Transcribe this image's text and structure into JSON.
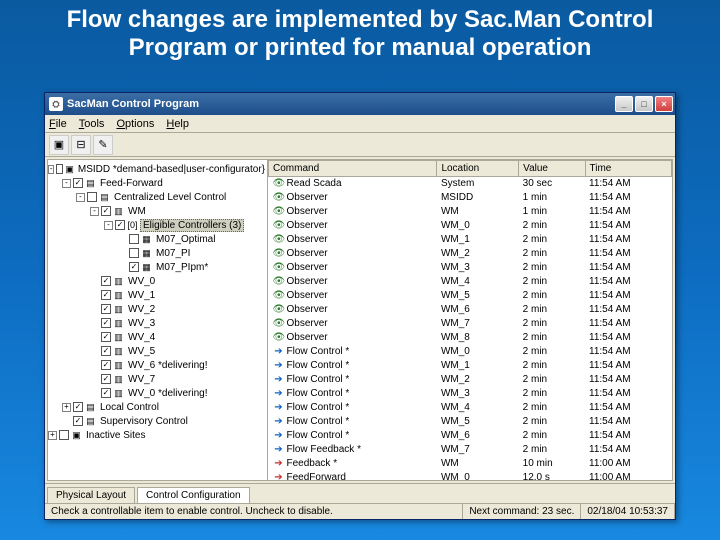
{
  "slide": {
    "title": "Flow changes are implemented by Sac.Man Control Program or printed for manual operation"
  },
  "window": {
    "title": "SacMan Control Program",
    "menu": {
      "file": "File",
      "tools": "Tools",
      "options": "Options",
      "help": "Help"
    },
    "win": {
      "min": "_",
      "max": "□",
      "close": "×"
    }
  },
  "tree": [
    {
      "d": 0,
      "exp": "-",
      "chk": "",
      "ico": "▣",
      "label": "MSIDD *demand-based|user-configurator}"
    },
    {
      "d": 1,
      "exp": "-",
      "chk": "✓",
      "ico": "▤",
      "label": "Feed-Forward"
    },
    {
      "d": 2,
      "exp": "-",
      "chk": "",
      "ico": "▤",
      "label": "Centralized Level Control"
    },
    {
      "d": 3,
      "exp": "-",
      "chk": "✓",
      "ico": "▥",
      "label": "WM"
    },
    {
      "d": 4,
      "exp": "-",
      "chk": "✓",
      "ico": "[0]",
      "label": "Eligible Controllers (3)",
      "sel": true
    },
    {
      "d": 5,
      "exp": "",
      "chk": "",
      "ico": "▦",
      "label": "M07_Optimal"
    },
    {
      "d": 5,
      "exp": "",
      "chk": "",
      "ico": "▦",
      "label": "M07_PI"
    },
    {
      "d": 5,
      "exp": "",
      "chk": "✓",
      "ico": "▦",
      "label": "M07_PIpm*"
    },
    {
      "d": 3,
      "exp": "",
      "chk": "✓",
      "ico": "▥",
      "label": "WV_0"
    },
    {
      "d": 3,
      "exp": "",
      "chk": "✓",
      "ico": "▥",
      "label": "WV_1"
    },
    {
      "d": 3,
      "exp": "",
      "chk": "✓",
      "ico": "▥",
      "label": "WV_2"
    },
    {
      "d": 3,
      "exp": "",
      "chk": "✓",
      "ico": "▥",
      "label": "WV_3"
    },
    {
      "d": 3,
      "exp": "",
      "chk": "✓",
      "ico": "▥",
      "label": "WV_4"
    },
    {
      "d": 3,
      "exp": "",
      "chk": "✓",
      "ico": "▥",
      "label": "WV_5"
    },
    {
      "d": 3,
      "exp": "",
      "chk": "✓",
      "ico": "▥",
      "label": "WV_6 *delivering!"
    },
    {
      "d": 3,
      "exp": "",
      "chk": "✓",
      "ico": "▥",
      "label": "WV_7"
    },
    {
      "d": 3,
      "exp": "",
      "chk": "✓",
      "ico": "▥",
      "label": "WV_0 *delivering!"
    },
    {
      "d": 1,
      "exp": "+",
      "chk": "✓",
      "ico": "▤",
      "label": "Local Control"
    },
    {
      "d": 1,
      "exp": "",
      "chk": "✓",
      "ico": "▤",
      "label": "Supervisory Control"
    },
    {
      "d": 0,
      "exp": "+",
      "chk": "",
      "ico": "▣",
      "label": "Inactive Sites"
    }
  ],
  "columns": {
    "command": "Command",
    "location": "Location",
    "value": "Value",
    "time": "Time"
  },
  "rows": [
    {
      "icon": "eye",
      "cmd": "Read Scada",
      "loc": "System",
      "val": "30 sec",
      "time": "11:54 AM"
    },
    {
      "icon": "eye",
      "cmd": "Observer",
      "loc": "MSIDD",
      "val": "1 min",
      "time": "11:54 AM"
    },
    {
      "icon": "eye",
      "cmd": "Observer",
      "loc": "WM",
      "val": "1 min",
      "time": "11:54 AM"
    },
    {
      "icon": "eye",
      "cmd": "Observer",
      "loc": "WM_0",
      "val": "2 min",
      "time": "11:54 AM"
    },
    {
      "icon": "eye",
      "cmd": "Observer",
      "loc": "WM_1",
      "val": "2 min",
      "time": "11:54 AM"
    },
    {
      "icon": "eye",
      "cmd": "Observer",
      "loc": "WM_2",
      "val": "2 min",
      "time": "11:54 AM"
    },
    {
      "icon": "eye",
      "cmd": "Observer",
      "loc": "WM_3",
      "val": "2 min",
      "time": "11:54 AM"
    },
    {
      "icon": "eye",
      "cmd": "Observer",
      "loc": "WM_4",
      "val": "2 min",
      "time": "11:54 AM"
    },
    {
      "icon": "eye",
      "cmd": "Observer",
      "loc": "WM_5",
      "val": "2 min",
      "time": "11:54 AM"
    },
    {
      "icon": "eye",
      "cmd": "Observer",
      "loc": "WM_6",
      "val": "2 min",
      "time": "11:54 AM"
    },
    {
      "icon": "eye",
      "cmd": "Observer",
      "loc": "WM_7",
      "val": "2 min",
      "time": "11:54 AM"
    },
    {
      "icon": "eye",
      "cmd": "Observer",
      "loc": "WM_8",
      "val": "2 min",
      "time": "11:54 AM"
    },
    {
      "icon": "arrow",
      "cmd": "Flow Control *",
      "loc": "WM_0",
      "val": "2 min",
      "time": "11:54 AM"
    },
    {
      "icon": "arrow",
      "cmd": "Flow Control *",
      "loc": "WM_1",
      "val": "2 min",
      "time": "11:54 AM"
    },
    {
      "icon": "arrow",
      "cmd": "Flow Control *",
      "loc": "WM_2",
      "val": "2 min",
      "time": "11:54 AM"
    },
    {
      "icon": "arrow",
      "cmd": "Flow Control *",
      "loc": "WM_3",
      "val": "2 min",
      "time": "11:54 AM"
    },
    {
      "icon": "arrow",
      "cmd": "Flow Control *",
      "loc": "WM_4",
      "val": "2 min",
      "time": "11:54 AM"
    },
    {
      "icon": "arrow",
      "cmd": "Flow Control *",
      "loc": "WM_5",
      "val": "2 min",
      "time": "11:54 AM"
    },
    {
      "icon": "arrow",
      "cmd": "Flow Control *",
      "loc": "WM_6",
      "val": "2 min",
      "time": "11:54 AM"
    },
    {
      "icon": "arrow",
      "cmd": "Flow Feedback *",
      "loc": "WM_7",
      "val": "2 min",
      "time": "11:54 AM"
    },
    {
      "icon": "arrow-red",
      "cmd": "Feedback *",
      "loc": "WM",
      "val": "10 min",
      "time": "11:00 AM"
    },
    {
      "icon": "arrow-red",
      "cmd": "FeedForward",
      "loc": "WM_0",
      "val": "12.0 s",
      "time": "11:00 AM"
    }
  ],
  "tabs": {
    "physical": "Physical Layout",
    "control": "Control Configuration"
  },
  "status": {
    "hint": "Check a controllable item to enable control.  Uncheck to disable.",
    "next": "Next command: 23 sec.",
    "clock": "02/18/04 10:53:37"
  }
}
